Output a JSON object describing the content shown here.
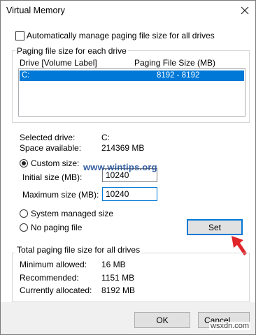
{
  "window": {
    "title": "Virtual Memory"
  },
  "auto_manage": {
    "label": "Automatically manage paging file size for all drives",
    "checked": false
  },
  "drives_group": {
    "legend": "Paging file size for each drive",
    "col_drive": "Drive  [Volume Label]",
    "col_size": "Paging File Size (MB)",
    "rows": [
      {
        "drive": "C:",
        "size": "8192 - 8192",
        "selected": true
      }
    ]
  },
  "selected_drive": {
    "label": "Selected drive:",
    "value": "C:"
  },
  "space_available": {
    "label": "Space available:",
    "value": "214369 MB"
  },
  "custom_size": {
    "label": "Custom size:",
    "selected": true
  },
  "initial_size": {
    "label": "Initial size (MB):",
    "value": "10240"
  },
  "maximum_size": {
    "label": "Maximum size (MB):",
    "value": "10240"
  },
  "system_managed": {
    "label": "System managed size",
    "selected": false
  },
  "no_paging": {
    "label": "No paging file",
    "selected": false
  },
  "set_button": {
    "label": "Set"
  },
  "totals_group": {
    "legend": "Total paging file size for all drives",
    "min_label": "Minimum allowed:",
    "min_value": "16 MB",
    "rec_label": "Recommended:",
    "rec_value": "1151 MB",
    "cur_label": "Currently allocated:",
    "cur_value": "8192 MB"
  },
  "ok_button": {
    "label": "OK"
  },
  "cancel_button": {
    "label": "Cancel"
  },
  "watermarks": {
    "center": "www.wintips.org",
    "corner": "wsxdn.com"
  },
  "colors": {
    "accent": "#0078d7",
    "arrow": "#e0252b"
  }
}
